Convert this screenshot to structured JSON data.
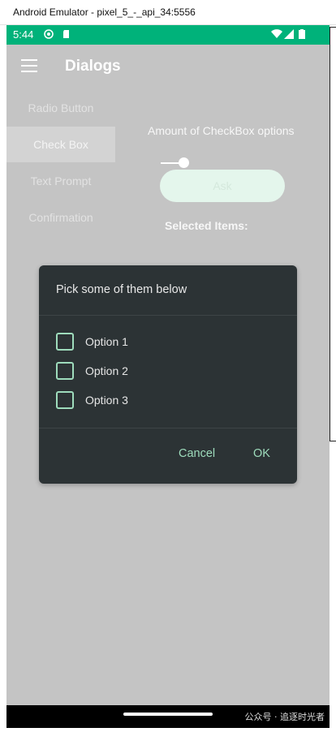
{
  "window": {
    "title": "Android Emulator - pixel_5_-_api_34:5556"
  },
  "status_bar": {
    "time": "5:44"
  },
  "app_bar": {
    "title": "Dialogs",
    "menu_icon": "hamburger-icon"
  },
  "sidebar": {
    "items": [
      {
        "label": "Radio Button",
        "active": false
      },
      {
        "label": "Check Box",
        "active": true
      },
      {
        "label": "Text Prompt",
        "active": false
      },
      {
        "label": "Confirmation",
        "active": false
      }
    ]
  },
  "main": {
    "amount_label": "Amount of CheckBox options",
    "ask_label": "Ask",
    "selected_label": "Selected Items:"
  },
  "dialog": {
    "title": "Pick some of them below",
    "options": [
      {
        "label": "Option 1",
        "checked": false
      },
      {
        "label": "Option 2",
        "checked": false
      },
      {
        "label": "Option 3",
        "checked": false
      }
    ],
    "cancel_label": "Cancel",
    "ok_label": "OK"
  },
  "watermark": "公众号 · 追逐时光者",
  "colors": {
    "status_bar": "#00b27a",
    "scrim": "#c4c4c4",
    "dialog_bg": "#2c3335",
    "accent": "#9edcbc"
  }
}
